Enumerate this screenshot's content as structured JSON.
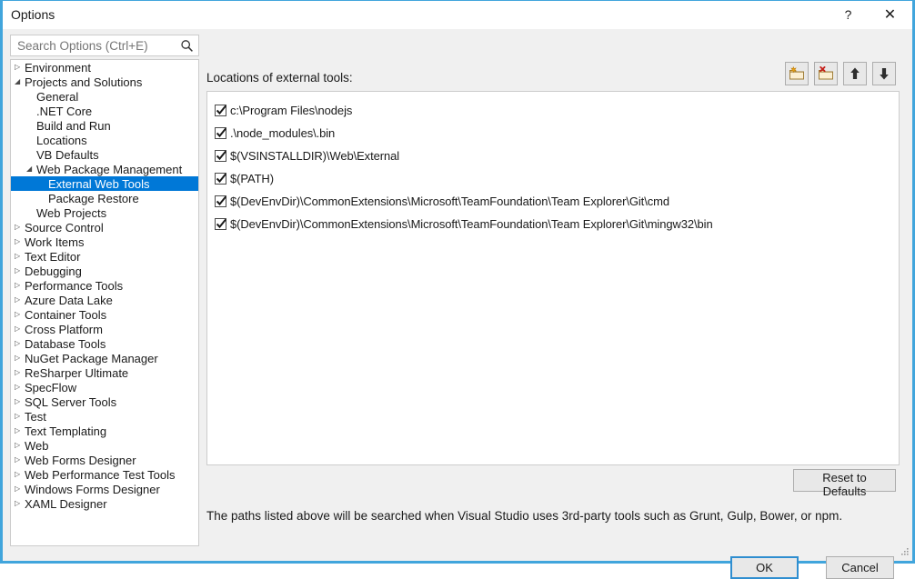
{
  "window": {
    "title": "Options",
    "help_label": "?",
    "close_label": "✕",
    "accent_border": "#41a5dc"
  },
  "search": {
    "placeholder": "Search Options (Ctrl+E)",
    "value": "",
    "icon": "search-icon"
  },
  "sidebar": {
    "selection_color": "#0078d7",
    "collapsed_glyph": "▷",
    "expanded_glyph": "◢",
    "items": [
      {
        "label": "Environment",
        "indent": 0,
        "state": "collapsed",
        "selected": false
      },
      {
        "label": "Projects and Solutions",
        "indent": 0,
        "state": "expanded",
        "selected": false
      },
      {
        "label": "General",
        "indent": 1,
        "state": "leaf",
        "selected": false
      },
      {
        "label": ".NET Core",
        "indent": 1,
        "state": "leaf",
        "selected": false
      },
      {
        "label": "Build and Run",
        "indent": 1,
        "state": "leaf",
        "selected": false
      },
      {
        "label": "Locations",
        "indent": 1,
        "state": "leaf",
        "selected": false
      },
      {
        "label": "VB Defaults",
        "indent": 1,
        "state": "leaf",
        "selected": false
      },
      {
        "label": "Web Package Management",
        "indent": 1,
        "state": "expanded",
        "selected": false
      },
      {
        "label": "External Web Tools",
        "indent": 2,
        "state": "leaf",
        "selected": true
      },
      {
        "label": "Package Restore",
        "indent": 2,
        "state": "leaf",
        "selected": false
      },
      {
        "label": "Web Projects",
        "indent": 1,
        "state": "leaf",
        "selected": false
      },
      {
        "label": "Source Control",
        "indent": 0,
        "state": "collapsed",
        "selected": false
      },
      {
        "label": "Work Items",
        "indent": 0,
        "state": "collapsed",
        "selected": false
      },
      {
        "label": "Text Editor",
        "indent": 0,
        "state": "collapsed",
        "selected": false
      },
      {
        "label": "Debugging",
        "indent": 0,
        "state": "collapsed",
        "selected": false
      },
      {
        "label": "Performance Tools",
        "indent": 0,
        "state": "collapsed",
        "selected": false
      },
      {
        "label": "Azure Data Lake",
        "indent": 0,
        "state": "collapsed",
        "selected": false
      },
      {
        "label": "Container Tools",
        "indent": 0,
        "state": "collapsed",
        "selected": false
      },
      {
        "label": "Cross Platform",
        "indent": 0,
        "state": "collapsed",
        "selected": false
      },
      {
        "label": "Database Tools",
        "indent": 0,
        "state": "collapsed",
        "selected": false
      },
      {
        "label": "NuGet Package Manager",
        "indent": 0,
        "state": "collapsed",
        "selected": false
      },
      {
        "label": "ReSharper Ultimate",
        "indent": 0,
        "state": "collapsed",
        "selected": false
      },
      {
        "label": "SpecFlow",
        "indent": 0,
        "state": "collapsed",
        "selected": false
      },
      {
        "label": "SQL Server Tools",
        "indent": 0,
        "state": "collapsed",
        "selected": false
      },
      {
        "label": "Test",
        "indent": 0,
        "state": "collapsed",
        "selected": false
      },
      {
        "label": "Text Templating",
        "indent": 0,
        "state": "collapsed",
        "selected": false
      },
      {
        "label": "Web",
        "indent": 0,
        "state": "collapsed",
        "selected": false
      },
      {
        "label": "Web Forms Designer",
        "indent": 0,
        "state": "collapsed",
        "selected": false
      },
      {
        "label": "Web Performance Test Tools",
        "indent": 0,
        "state": "collapsed",
        "selected": false
      },
      {
        "label": "Windows Forms Designer",
        "indent": 0,
        "state": "collapsed",
        "selected": false
      },
      {
        "label": "XAML Designer",
        "indent": 0,
        "state": "collapsed",
        "selected": false
      }
    ]
  },
  "main": {
    "label": "Locations of external tools:",
    "toolbar": [
      {
        "name": "add-folder-button",
        "tooltip": "Add"
      },
      {
        "name": "delete-folder-button",
        "tooltip": "Delete"
      },
      {
        "name": "move-up-button",
        "tooltip": "Move Up"
      },
      {
        "name": "move-down-button",
        "tooltip": "Move Down"
      }
    ],
    "paths": [
      {
        "text": "c:\\Program Files\\nodejs",
        "checked": true
      },
      {
        "text": ".\\node_modules\\.bin",
        "checked": true
      },
      {
        "text": "$(VSINSTALLDIR)\\Web\\External",
        "checked": true
      },
      {
        "text": "$(PATH)",
        "checked": true
      },
      {
        "text": "$(DevEnvDir)\\CommonExtensions\\Microsoft\\TeamFoundation\\Team Explorer\\Git\\cmd",
        "checked": true
      },
      {
        "text": "$(DevEnvDir)\\CommonExtensions\\Microsoft\\TeamFoundation\\Team Explorer\\Git\\mingw32\\bin",
        "checked": true
      }
    ],
    "reset_label": "Reset to Defaults",
    "footer_note": "The paths listed above will be searched when Visual Studio uses 3rd-party tools such as Grunt, Gulp, Bower, or npm."
  },
  "footer": {
    "ok_label": "OK",
    "cancel_label": "Cancel"
  }
}
